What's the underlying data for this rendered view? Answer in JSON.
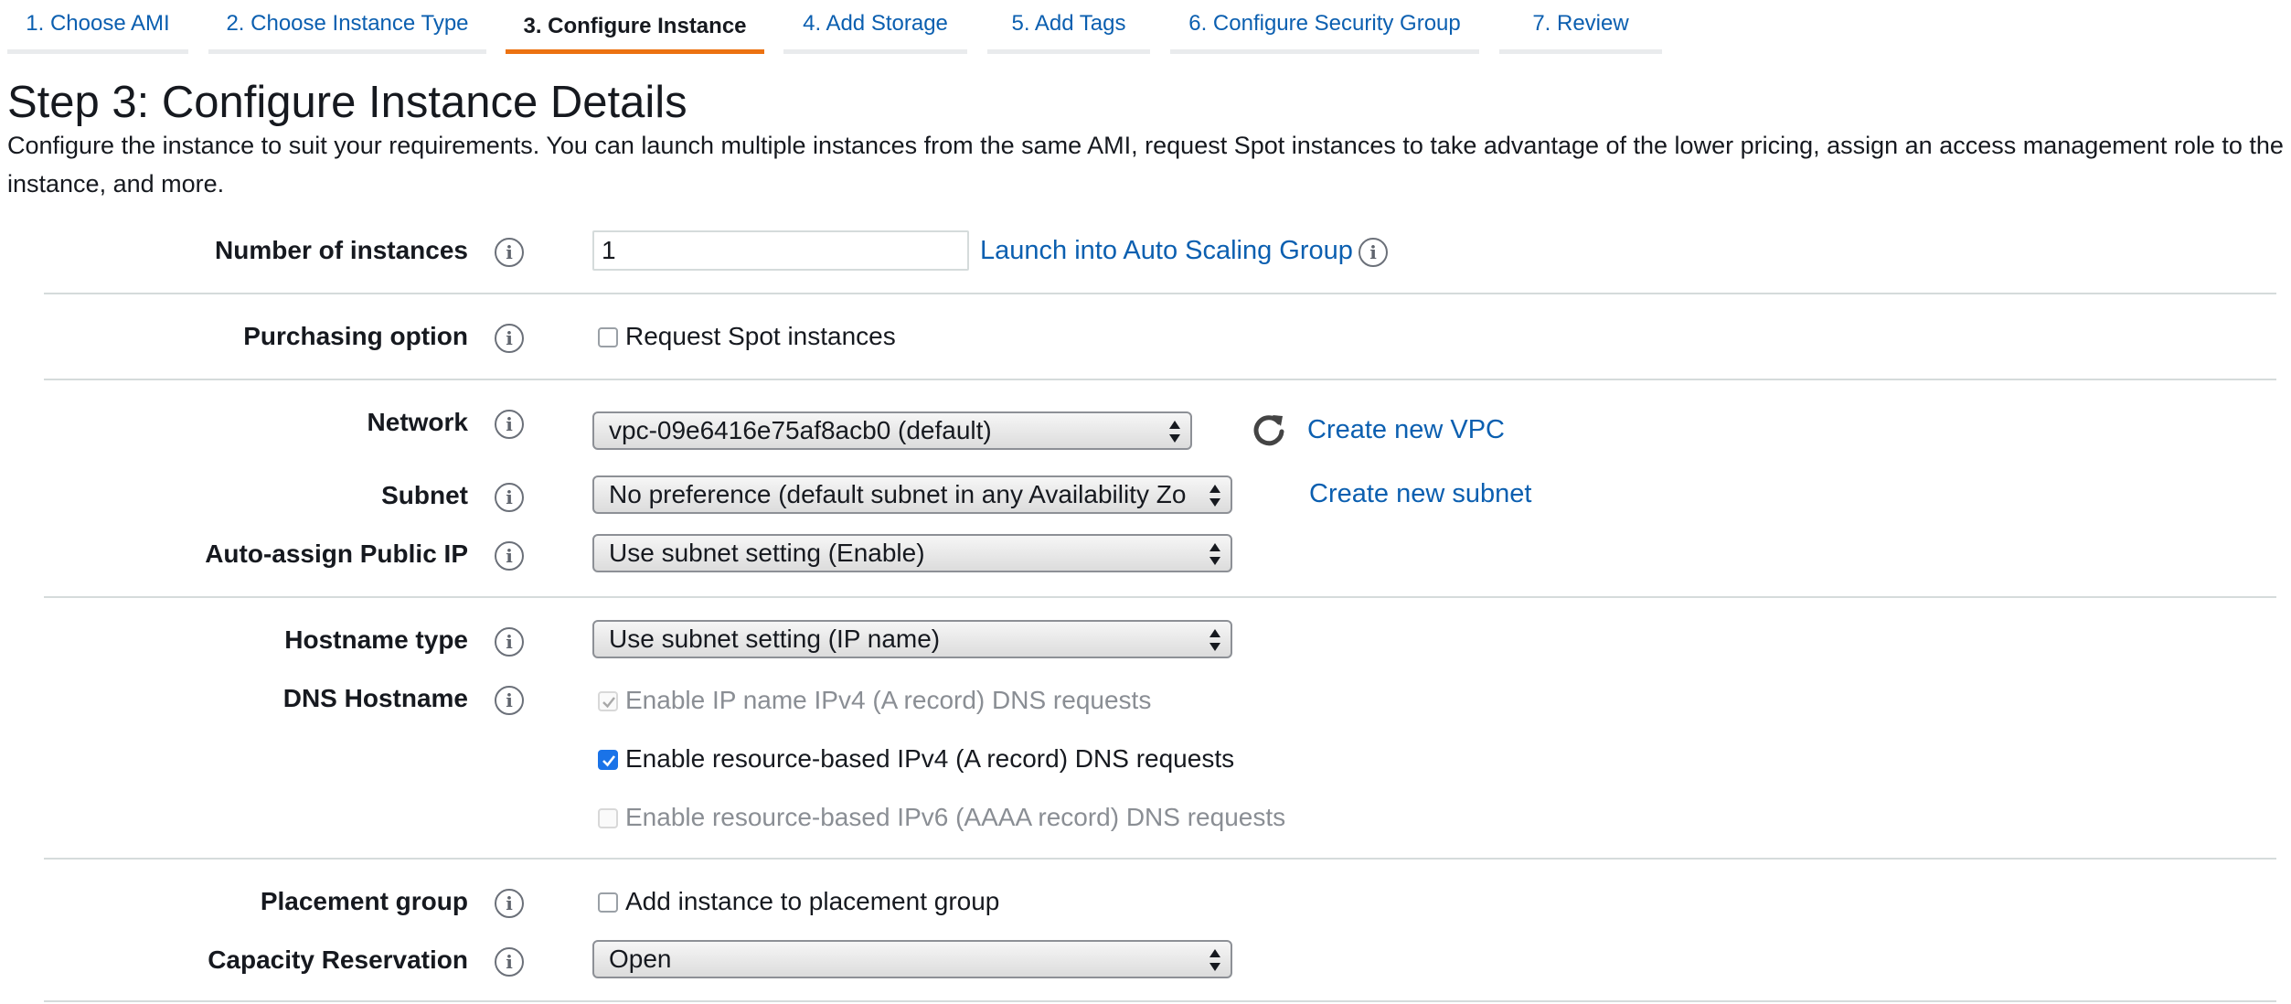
{
  "wizard": {
    "steps": [
      {
        "label": "1. Choose AMI"
      },
      {
        "label": "2. Choose Instance Type"
      },
      {
        "label": "3. Configure Instance"
      },
      {
        "label": "4. Add Storage"
      },
      {
        "label": "5. Add Tags"
      },
      {
        "label": "6. Configure Security Group"
      },
      {
        "label": "7. Review"
      }
    ],
    "active_step": "3. Configure Instance"
  },
  "page": {
    "title": "Step 3: Configure Instance Details",
    "description": "Configure the instance to suit your requirements. You can launch multiple instances from the same AMI, request Spot instances to take advantage of the lower pricing, assign an access management role to the instance, and more."
  },
  "form": {
    "number_of_instances": {
      "label": "Number of instances",
      "value": "1",
      "link": "Launch into Auto Scaling Group"
    },
    "purchasing_option": {
      "label": "Purchasing option",
      "checkbox_label": "Request Spot instances",
      "checked": false
    },
    "network": {
      "label": "Network",
      "value": "vpc-09e6416e75af8acb0 (default)",
      "link": "Create new VPC"
    },
    "subnet": {
      "label": "Subnet",
      "value": "No preference (default subnet in any Availability Zo",
      "link": "Create new subnet"
    },
    "auto_assign_public_ip": {
      "label": "Auto-assign Public IP",
      "value": "Use subnet setting (Enable)"
    },
    "hostname_type": {
      "label": "Hostname type",
      "value": "Use subnet setting (IP name)"
    },
    "dns_hostname": {
      "label": "DNS Hostname",
      "options": [
        {
          "label": "Enable IP name IPv4 (A record) DNS requests",
          "checked": true,
          "disabled": true
        },
        {
          "label": "Enable resource-based IPv4 (A record) DNS requests",
          "checked": true,
          "disabled": false
        },
        {
          "label": "Enable resource-based IPv6 (AAAA record) DNS requests",
          "checked": false,
          "disabled": true
        }
      ]
    },
    "placement_group": {
      "label": "Placement group",
      "checkbox_label": "Add instance to placement group",
      "checked": false
    },
    "capacity_reservation": {
      "label": "Capacity Reservation",
      "value": "Open"
    }
  },
  "icons": {
    "info": "i",
    "refresh": "refresh-icon"
  },
  "colors": {
    "link": "#0b5fb0",
    "active_tab_underline": "#ec7211",
    "checkbox_checked": "#1a73e8"
  }
}
